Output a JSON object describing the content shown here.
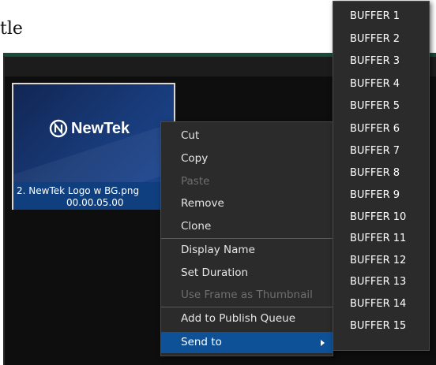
{
  "document": {
    "title_fragment": "tle"
  },
  "clip": {
    "name": "2. NewTek Logo w BG.png",
    "duration": "00.00.05.00",
    "logo_text": "NewTek",
    "logo_icon": "newtek-logo-icon"
  },
  "context_menu": {
    "items": [
      {
        "label": "Cut",
        "enabled": true
      },
      {
        "label": "Copy",
        "enabled": true
      },
      {
        "label": "Paste",
        "enabled": false
      },
      {
        "label": "Remove",
        "enabled": true
      },
      {
        "label": "Clone",
        "enabled": true
      },
      {
        "label": "Display Name",
        "enabled": true
      },
      {
        "label": "Set Duration",
        "enabled": true
      },
      {
        "label": "Use Frame as Thumbnail",
        "enabled": false
      },
      {
        "label": "Add to Publish Queue",
        "enabled": true
      },
      {
        "label": "Send to",
        "enabled": true,
        "highlighted": true,
        "submenu_icon": "chevron-right-icon"
      }
    ]
  },
  "send_to_submenu": {
    "items": [
      "BUFFER 1",
      "BUFFER 2",
      "BUFFER 3",
      "BUFFER 4",
      "BUFFER 5",
      "BUFFER 6",
      "BUFFER 7",
      "BUFFER 8",
      "BUFFER 9",
      "BUFFER 10",
      "BUFFER 11",
      "BUFFER 12",
      "BUFFER 13",
      "BUFFER 14",
      "BUFFER 15"
    ]
  },
  "colors": {
    "menu_background": "#2b2b2b",
    "highlight": "#0e5196",
    "clip_background": "#0f3f7e",
    "panel_accent": "#174b3a"
  }
}
